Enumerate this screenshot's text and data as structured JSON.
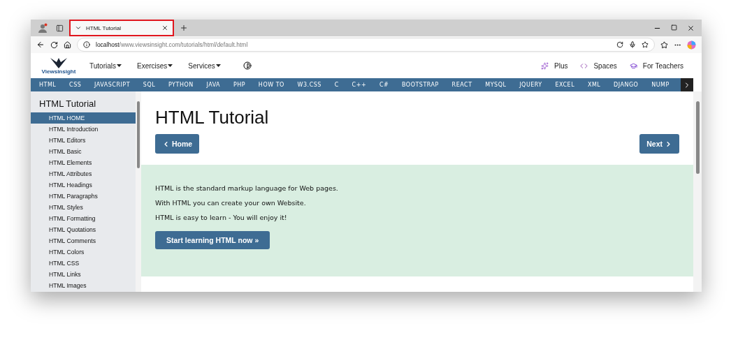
{
  "browser": {
    "tabs": [
      {
        "title": "HTML Tutorial",
        "selected": true,
        "highlighted": true
      }
    ],
    "address": {
      "host": "localhost",
      "path": "/www.viewsinsight.com/tutorials/html/default.html"
    }
  },
  "site_header": {
    "logo_text": "Viewsinsight",
    "menus": [
      {
        "label": "Tutorials"
      },
      {
        "label": "Exercises"
      },
      {
        "label": "Services"
      }
    ],
    "right_links": [
      {
        "label": "Plus",
        "kind": "sparkle"
      },
      {
        "label": "Spaces",
        "kind": "code"
      },
      {
        "label": "For Teachers",
        "kind": "cap"
      }
    ]
  },
  "topics_nav": [
    "HTML",
    "CSS",
    "JAVASCRIPT",
    "SQL",
    "PYTHON",
    "JAVA",
    "PHP",
    "HOW TO",
    "W3.CSS",
    "C",
    "C++",
    "C#",
    "BOOTSTRAP",
    "REACT",
    "MYSQL",
    "JQUERY",
    "EXCEL",
    "XML",
    "DJANGO",
    "NUMP"
  ],
  "sidebar": {
    "title": "HTML Tutorial",
    "items": [
      {
        "label": "HTML HOME",
        "selected": true
      },
      {
        "label": "HTML Introduction",
        "selected": false
      },
      {
        "label": "HTML Editors",
        "selected": false
      },
      {
        "label": "HTML Basic",
        "selected": false
      },
      {
        "label": "HTML Elements",
        "selected": false
      },
      {
        "label": "HTML Attributes",
        "selected": false
      },
      {
        "label": "HTML Headings",
        "selected": false
      },
      {
        "label": "HTML Paragraphs",
        "selected": false
      },
      {
        "label": "HTML Styles",
        "selected": false
      },
      {
        "label": "HTML Formatting",
        "selected": false
      },
      {
        "label": "HTML Quotations",
        "selected": false
      },
      {
        "label": "HTML Comments",
        "selected": false
      },
      {
        "label": "HTML Colors",
        "selected": false
      },
      {
        "label": "HTML CSS",
        "selected": false
      },
      {
        "label": "HTML Links",
        "selected": false
      },
      {
        "label": "HTML Images",
        "selected": false
      }
    ]
  },
  "main": {
    "title": "HTML Tutorial",
    "prev_button": "Home",
    "next_button": "Next",
    "intro": [
      "HTML is the standard markup language for Web pages.",
      "With HTML you can create your own Website.",
      "HTML is easy to learn - You will enjoy it!"
    ],
    "cta_button": "Start learning HTML now »"
  }
}
